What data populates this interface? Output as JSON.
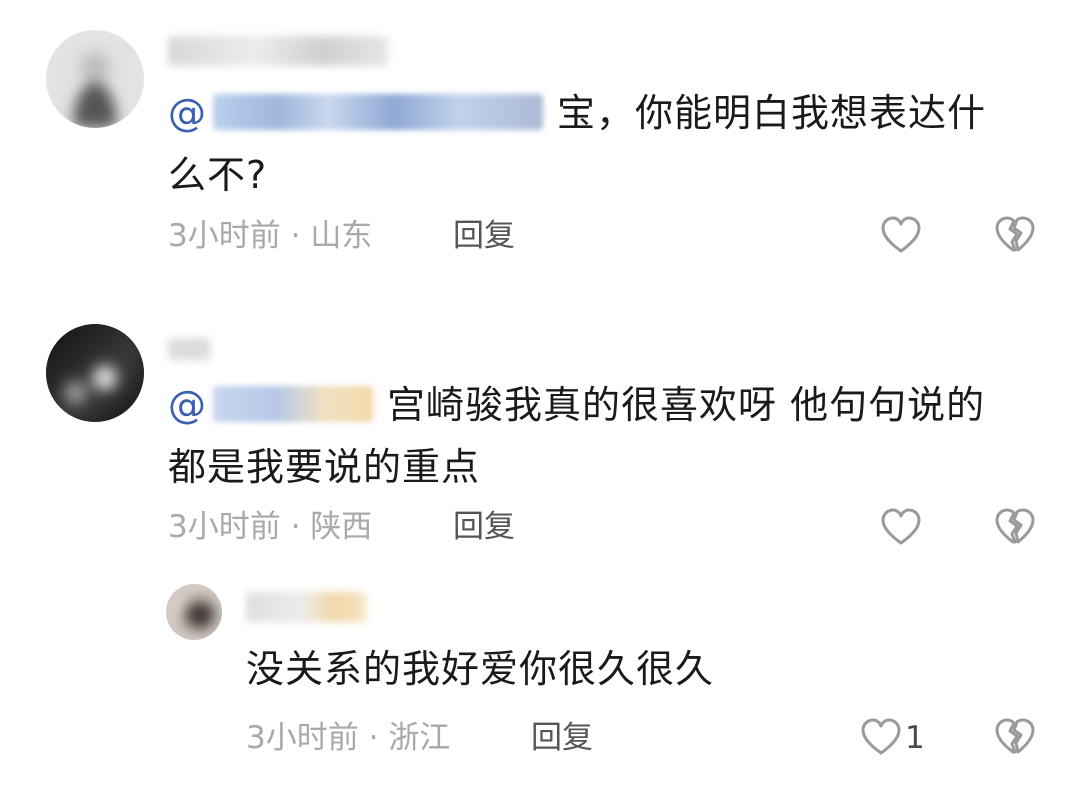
{
  "comments": [
    {
      "text_suffix": "宝，你能明白我想表达什",
      "text_line2": "么不?",
      "mention_prefix": "@",
      "time": "3小时前",
      "separator": "·",
      "location": "山东",
      "reply_label": "回复"
    },
    {
      "text_suffix": "宫崎骏我真的很喜欢呀  他句句说的",
      "text_line2": "都是我要说的重点",
      "mention_prefix": "@",
      "time": "3小时前",
      "separator": "·",
      "location": "陕西",
      "reply_label": "回复"
    },
    {
      "text": "没关系的我好爱你很久很久",
      "time": "3小时前",
      "separator": "·",
      "location": "浙江",
      "reply_label": "回复",
      "like_count": "1"
    }
  ],
  "icons": {
    "like": "heart-outline-icon",
    "dislike": "broken-heart-icon"
  },
  "colors": {
    "mention": "#3b5fb0",
    "meta": "#a9a9a9",
    "reply": "#555555",
    "icon": "#9a9a9a"
  }
}
